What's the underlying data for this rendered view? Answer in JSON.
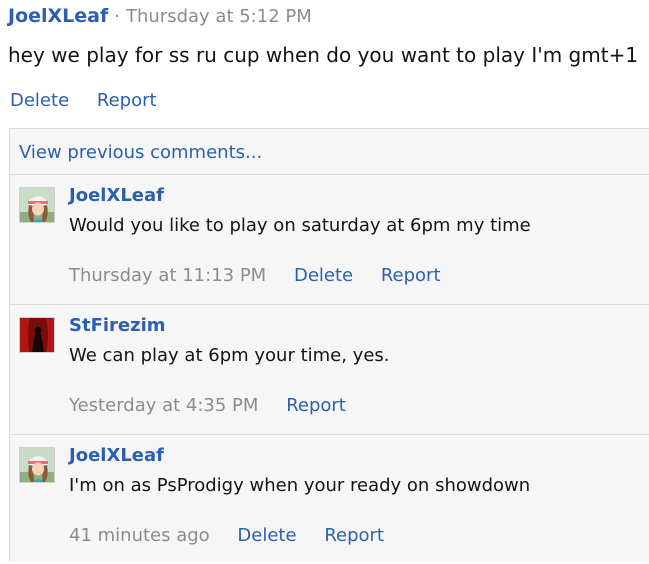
{
  "post": {
    "author": "JoelXLeaf",
    "separator": "·",
    "time": "Thursday at 5:12 PM",
    "body": "hey we play for ss ru cup when do you want to play I'm gmt+1",
    "delete_label": "Delete",
    "report_label": "Report"
  },
  "comments_panel": {
    "view_previous": "View previous comments..."
  },
  "comments": [
    {
      "author": "JoelXLeaf",
      "text": "Would you like to play on saturday at 6pm my time",
      "time": "Thursday at 11:13 PM",
      "delete_label": "Delete",
      "report_label": "Report"
    },
    {
      "author": "StFirezim",
      "text": "We can play at 6pm your time, yes.",
      "time": "Yesterday at 4:35 PM",
      "report_label": "Report"
    },
    {
      "author": "JoelXLeaf",
      "text": "I'm on as PsProdigy when your ready on showdown",
      "time": "41 minutes ago",
      "delete_label": "Delete",
      "report_label": "Report"
    }
  ],
  "colors": {
    "link": "#2b5fb0",
    "muted": "#8c8c8c",
    "panel_bg": "#f6f6f6",
    "border": "#dcdcdc"
  }
}
